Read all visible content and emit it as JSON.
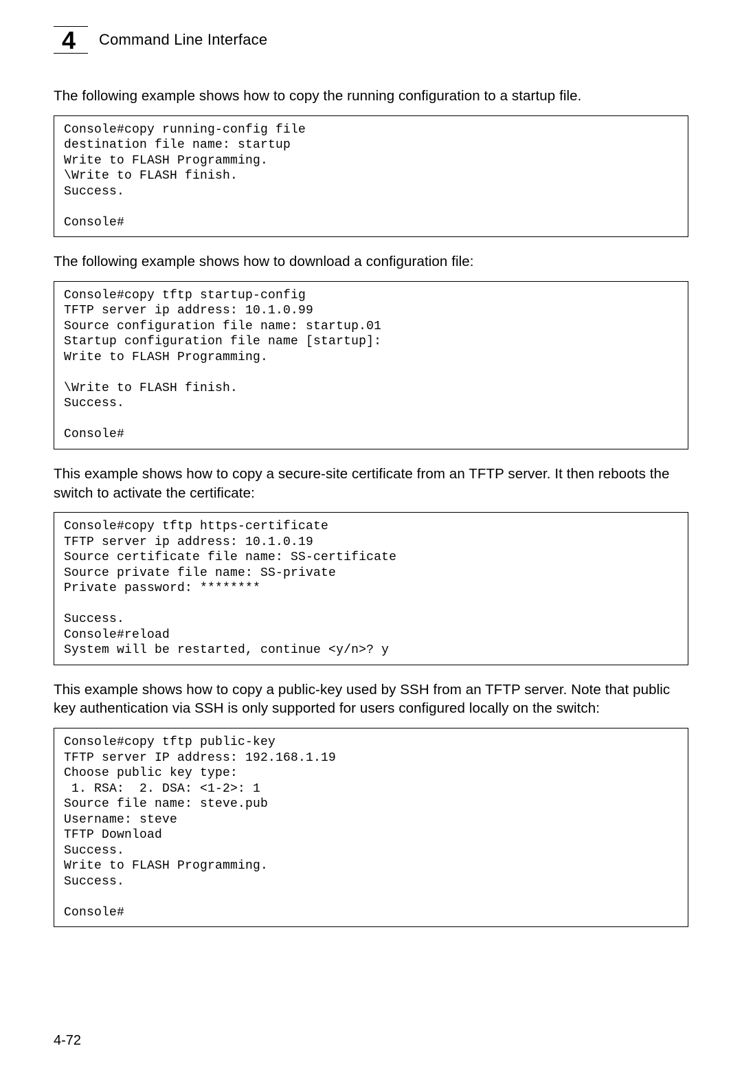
{
  "header": {
    "chapter_number": "4",
    "chapter_title": "Command Line Interface"
  },
  "paragraphs": {
    "p1": "The following example shows how to copy the running configuration to a startup file.",
    "p2": "The following example shows how to download a configuration file:",
    "p3": "This example shows how to copy a secure-site certificate from an TFTP server. It then reboots the switch to activate the certificate:",
    "p4": "This example shows how to copy a public-key used by SSH from an TFTP server. Note that public key authentication via SSH is only supported for users configured locally on the switch:"
  },
  "code_blocks": {
    "cb1": "Console#copy running-config file\ndestination file name: startup\nWrite to FLASH Programming.\n\\Write to FLASH finish.\nSuccess.\n\nConsole#",
    "cb2": "Console#copy tftp startup-config\nTFTP server ip address: 10.1.0.99\nSource configuration file name: startup.01\nStartup configuration file name [startup]:\nWrite to FLASH Programming.\n\n\\Write to FLASH finish.\nSuccess.\n\nConsole#",
    "cb3": "Console#copy tftp https-certificate\nTFTP server ip address: 10.1.0.19\nSource certificate file name: SS-certificate\nSource private file name: SS-private\nPrivate password: ********\n\nSuccess.\nConsole#reload\nSystem will be restarted, continue <y/n>? y",
    "cb4": "Console#copy tftp public-key\nTFTP server IP address: 192.168.1.19\nChoose public key type:\n 1. RSA:  2. DSA: <1-2>: 1\nSource file name: steve.pub\nUsername: steve\nTFTP Download\nSuccess.\nWrite to FLASH Programming.\nSuccess.\n\nConsole#"
  },
  "footer": {
    "page_number": "4-72"
  }
}
